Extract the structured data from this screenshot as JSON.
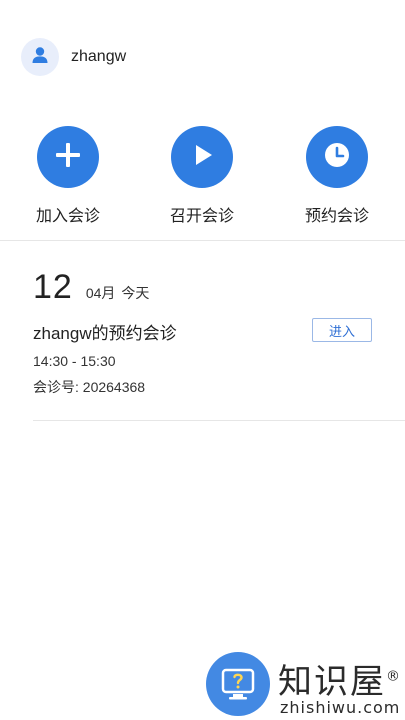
{
  "user": {
    "name": "zhangw",
    "avatar_icon": "user-icon"
  },
  "actions": [
    {
      "label": "加入会诊",
      "icon": "plus-icon"
    },
    {
      "label": "召开会诊",
      "icon": "play-icon"
    },
    {
      "label": "预约会诊",
      "icon": "clock-icon"
    }
  ],
  "schedule": {
    "day": "12",
    "month": "04月",
    "today": "今天"
  },
  "meeting": {
    "title": "zhangw的预约会诊",
    "time": "14:30 - 15:30",
    "id_text": "会诊号: 20264368",
    "enter_label": "进入"
  },
  "watermark": {
    "cn": "知识屋",
    "registered": "®",
    "en": "zhishiwu.com"
  },
  "colors": {
    "accent": "#2f7de1",
    "button_text": "#2f6fd4"
  }
}
